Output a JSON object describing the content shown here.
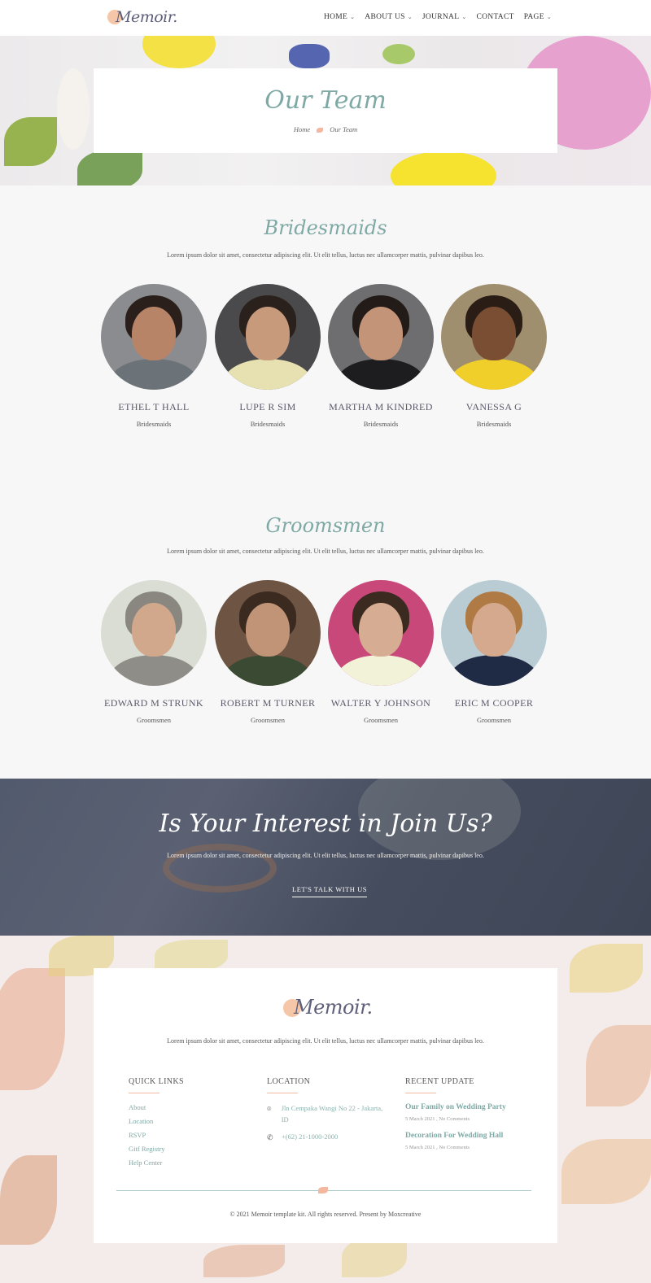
{
  "header": {
    "logo": "Memoir.",
    "nav": [
      {
        "label": "HOME",
        "dropdown": true
      },
      {
        "label": "ABOUT US",
        "dropdown": true
      },
      {
        "label": "JOURNAL",
        "dropdown": true
      },
      {
        "label": "CONTACT",
        "dropdown": false
      },
      {
        "label": "PAGE",
        "dropdown": true
      }
    ]
  },
  "hero": {
    "title": "Our Team",
    "breadcrumb": {
      "home": "Home",
      "current": "Our Team"
    }
  },
  "bridesmaids": {
    "title": "Bridesmaids",
    "description": "Lorem ipsum dolor sit amet, consectetur adipiscing elit. Ut elit tellus, luctus nec ullamcorper mattis, pulvinar dapibus leo.",
    "members": [
      {
        "name": "ETHEL T HALL",
        "role": "Bridesmaids",
        "skin": "#b88468",
        "hair": "#2a1f1a",
        "shirt": "#6b7378",
        "bg": "#8b8c8f"
      },
      {
        "name": "LUPE R SIM",
        "role": "Bridesmaids",
        "skin": "#c89a7c",
        "hair": "#2b211c",
        "shirt": "#e7e0b0",
        "bg": "#4a4a4d"
      },
      {
        "name": "MARTHA M KINDRED",
        "role": "Bridesmaids",
        "skin": "#c49478",
        "hair": "#231b18",
        "shirt": "#1d1d1f",
        "bg": "#6e6e70"
      },
      {
        "name": "VANESSA G",
        "role": "Bridesmaids",
        "skin": "#7a4e33",
        "hair": "#2a1d15",
        "shirt": "#f1cf2a",
        "bg": "#a08f6e"
      }
    ]
  },
  "groomsmen": {
    "title": "Groomsmen",
    "description": "Lorem ipsum dolor sit amet, consectetur adipiscing elit. Ut elit tellus, luctus nec ullamcorper mattis, pulvinar dapibus leo.",
    "members": [
      {
        "name": "EDWARD M STRUNK",
        "role": "Groomsmen",
        "skin": "#d1a88c",
        "hair": "#8a8680",
        "shirt": "#8f8d88",
        "bg": "#d9ddd4"
      },
      {
        "name": "ROBERT M TURNER",
        "role": "Groomsmen",
        "skin": "#c29477",
        "hair": "#3a2a1f",
        "shirt": "#3b4a33",
        "bg": "#6e5442"
      },
      {
        "name": "WALTER Y JOHNSON",
        "role": "Groomsmen",
        "skin": "#d6ad92",
        "hair": "#3a2a20",
        "shirt": "#f2f2d8",
        "bg": "#c8487a"
      },
      {
        "name": "ERIC M COOPER",
        "role": "Groomsmen",
        "skin": "#d4a98d",
        "hair": "#b07a45",
        "shirt": "#1f2a45",
        "bg": "#b9ccd4"
      }
    ]
  },
  "cta": {
    "title": "Is Your Interest in Join Us?",
    "description": "Lorem ipsum dolor sit amet, consectetur adipiscing elit. Ut elit tellus, luctus nec ullamcorper mattis, pulvinar dapibus leo.",
    "button": "LET'S TALK WITH US"
  },
  "footer": {
    "logo": "Memoir.",
    "description": "Lorem ipsum dolor sit amet, consectetur adipiscing elit. Ut elit tellus, luctus nec ullamcorper mattis, pulvinar dapibus leo.",
    "quick_links": {
      "heading": "QUICK LINKS",
      "items": [
        "About",
        "Location",
        "RSVP",
        "Gitf Registry",
        "Help Center"
      ]
    },
    "location": {
      "heading": "LOCATION",
      "address": "Jln Cempaka Wangi No 22 - Jakarta, ID",
      "phone": "+(62) 21-1000-2000"
    },
    "recent": {
      "heading": "RECENT UPDATE",
      "posts": [
        {
          "title": "Our Family on Wedding Party",
          "meta": "5 March 2021 , No Comments"
        },
        {
          "title": "Decoration For Wedding Hall",
          "meta": "5 March 2021 , No Comments"
        }
      ]
    },
    "copyright": "© 2021 Memoir template kit. All rights reserved. Present by Moxcreative"
  },
  "colors": {
    "accent_teal": "#7ea9a4",
    "accent_peach": "#f3b8a0",
    "text_dark": "#5e5f7a"
  }
}
